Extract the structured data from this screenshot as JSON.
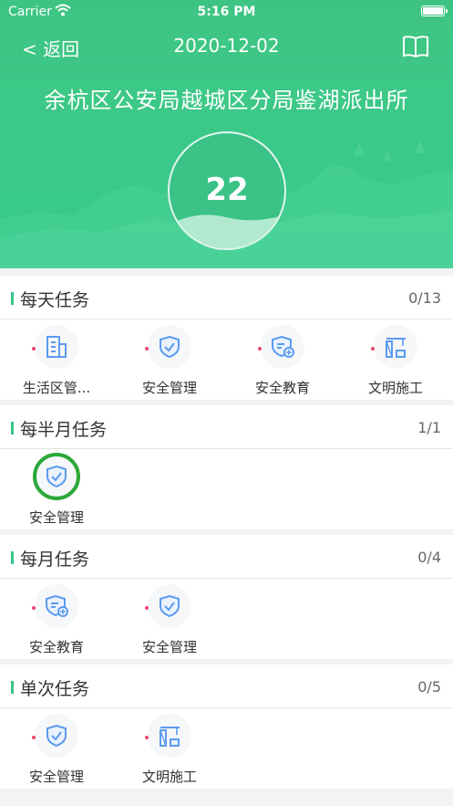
{
  "status_bar": {
    "carrier": "Carrier",
    "time": "5:16 PM"
  },
  "navbar": {
    "back_label": "< 返回",
    "date": "2020-12-02",
    "book_icon": "book-icon"
  },
  "banner": {
    "title": "余杭区公安局越城区分局鉴湖派出所",
    "count": "22"
  },
  "colors": {
    "primary": "#3ec482",
    "dot": "#f0456b",
    "done_ring": "#2aa838",
    "icon_blue": "#5b9bf0"
  },
  "sections": [
    {
      "title": "每天任务",
      "count": "0/13",
      "items": [
        {
          "label": "生活区管...",
          "icon": "building-icon",
          "dot": true
        },
        {
          "label": "安全管理",
          "icon": "shield-check-icon",
          "dot": true
        },
        {
          "label": "安全教育",
          "icon": "shield-plus-icon",
          "dot": true
        },
        {
          "label": "文明施工",
          "icon": "crane-icon",
          "dot": true
        }
      ]
    },
    {
      "title": "每半月任务",
      "count": "1/1",
      "items": [
        {
          "label": "安全管理",
          "icon": "shield-check-icon",
          "dot": false,
          "done": true
        }
      ]
    },
    {
      "title": "每月任务",
      "count": "0/4",
      "items": [
        {
          "label": "安全教育",
          "icon": "shield-plus-icon",
          "dot": true
        },
        {
          "label": "安全管理",
          "icon": "shield-check-icon",
          "dot": true
        }
      ]
    },
    {
      "title": "单次任务",
      "count": "0/5",
      "items": [
        {
          "label": "安全管理",
          "icon": "shield-check-icon",
          "dot": true
        },
        {
          "label": "文明施工",
          "icon": "crane-icon",
          "dot": true
        }
      ]
    }
  ]
}
